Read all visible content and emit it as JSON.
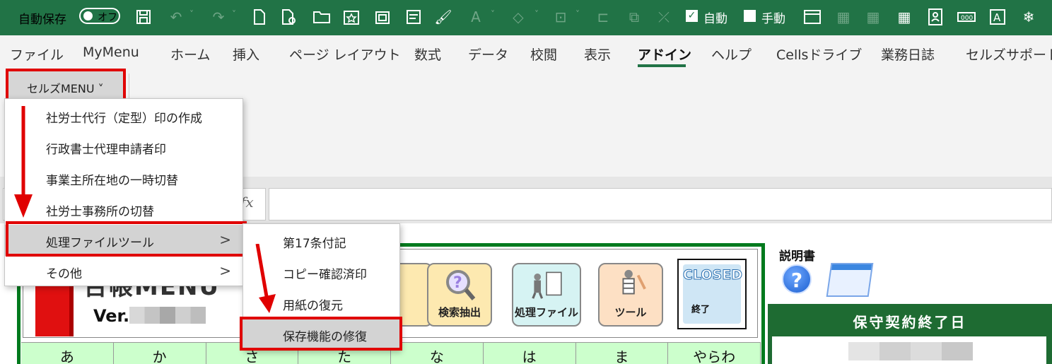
{
  "titlebar": {
    "autosave_label": "自動保存",
    "autosave_state": "オフ",
    "auto_label": "自動",
    "manual_label": "手動"
  },
  "ribbon": {
    "tabs": [
      "ファイル",
      "MyMenu",
      "ホーム",
      "挿入",
      "ページ レイアウト",
      "数式",
      "データ",
      "校閲",
      "表示",
      "アドイン",
      "ヘルプ",
      "Cellsドライブ",
      "業務日誌",
      "セルズサポート"
    ],
    "active_tab": "アドイン",
    "menu_button": "セルズMENU ˅"
  },
  "formula_bar": {
    "fx": "fx"
  },
  "menu_main": {
    "items": [
      {
        "label": "社労士代行（定型）印の作成"
      },
      {
        "label": "行政書士代理申請者印"
      },
      {
        "label": "事業主所在地の一時切替"
      },
      {
        "label": "社労士事務所の切替"
      },
      {
        "label": "処理ファイルツール",
        "arrow": ">"
      },
      {
        "label": "その他",
        "arrow": ">"
      }
    ]
  },
  "menu_sub": {
    "items": [
      {
        "label": "第17条付記"
      },
      {
        "label": "コピー確認済印"
      },
      {
        "label": "用紙の復元"
      },
      {
        "label": "保存機能の修復"
      }
    ]
  },
  "sheet": {
    "logo_text": "台帳MENU",
    "version_prefix": "Ver.",
    "cards": [
      "検索抽出",
      "処理ファイル",
      "ツール"
    ],
    "closed_title": "CLOSED",
    "closed_label": "終了",
    "kana": [
      "あ",
      "か",
      "さ",
      "た",
      "な",
      "は",
      "ま",
      "やらわ"
    ],
    "manual_label": "説明書",
    "help_glyph": "?",
    "contract_title": "保守契約終了日"
  },
  "colors": {
    "excel_green": "#217346",
    "highlight_red": "#e00000",
    "sheet_green": "#007a1e"
  }
}
